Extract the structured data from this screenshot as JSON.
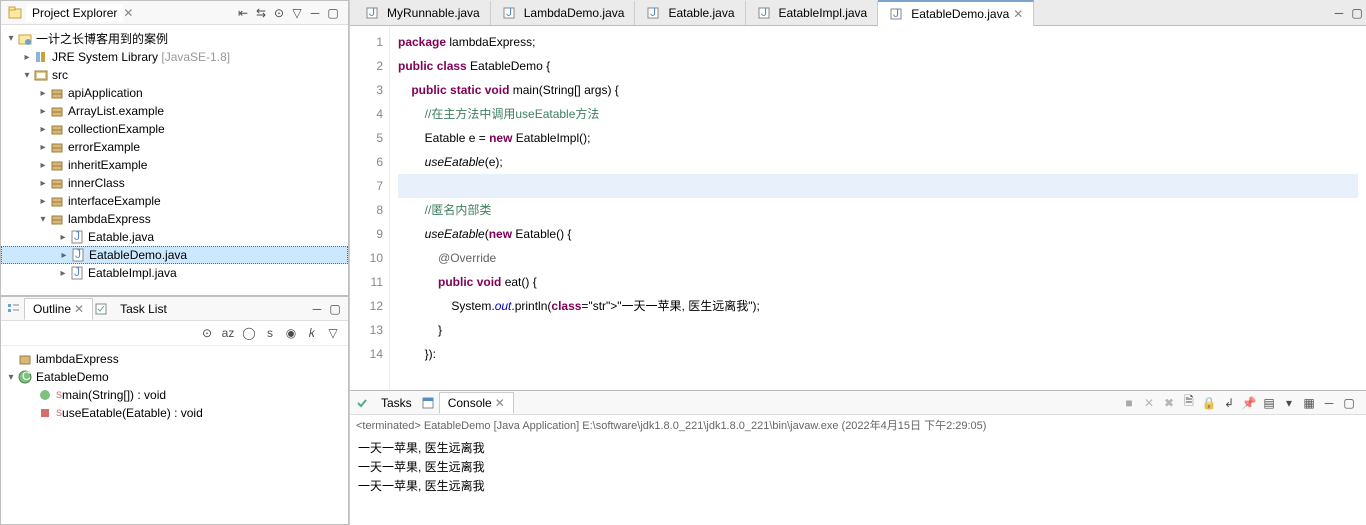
{
  "explorer": {
    "title": "Project Explorer",
    "project": "一计之长博客用到的案例",
    "jre": "JRE System Library",
    "jre_ver": "[JavaSE-1.8]",
    "src": "src",
    "packages": [
      "apiApplication",
      "ArrayList.example",
      "collectionExample",
      "errorExample",
      "inheritExample",
      "innerClass",
      "interfaceExample",
      "lambdaExpress"
    ],
    "files": [
      "Eatable.java",
      "EatableDemo.java",
      "EatableImpl.java"
    ],
    "selected_file": "EatableDemo.java"
  },
  "outline": {
    "tabs": [
      "Outline",
      "Task List"
    ],
    "package": "lambdaExpress",
    "class": "EatableDemo",
    "members": [
      {
        "name": "main(String[]) : void",
        "static": true,
        "vis": "public"
      },
      {
        "name": "useEatable(Eatable) : void",
        "static": true,
        "vis": "private"
      }
    ]
  },
  "editor": {
    "tabs": [
      "MyRunnable.java",
      "LambdaDemo.java",
      "Eatable.java",
      "EatableImpl.java",
      "EatableDemo.java"
    ],
    "active_tab": "EatableDemo.java",
    "code_lines_count": 14
  },
  "chart_data": {
    "type": "table",
    "note": "Java source displayed in editor",
    "lines": [
      "package lambdaExpress;",
      "public class EatableDemo {",
      "    public static void main(String[] args) {",
      "        //在主方法中调用useEatable方法",
      "        Eatable e = new EatableImpl();",
      "        useEatable(e);",
      "",
      "        //匿名内部类",
      "        useEatable(new Eatable() {",
      "            @Override",
      "            public void eat() {",
      "                System.out.println(\"一天一苹果, 医生远离我\");",
      "            }",
      "        }):"
    ]
  },
  "console": {
    "tabs": [
      "Tasks",
      "Console"
    ],
    "status": "<terminated> EatableDemo [Java Application] E:\\software\\jdk1.8.0_221\\jdk1.8.0_221\\bin\\javaw.exe (2022年4月15日 下午2:29:05)",
    "lines": [
      "一天一苹果, 医生远离我",
      "一天一苹果, 医生远离我",
      "一天一苹果, 医生远离我"
    ]
  }
}
